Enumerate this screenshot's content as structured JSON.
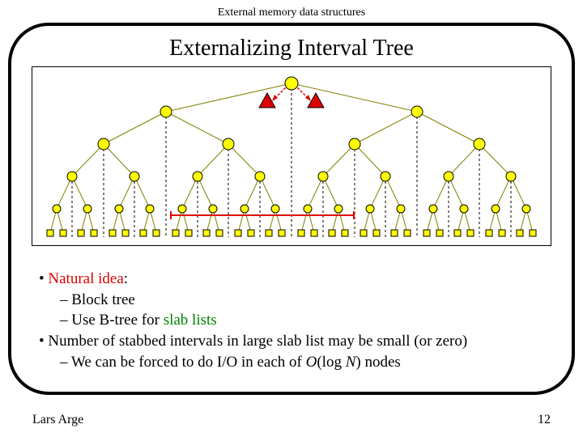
{
  "header": "External memory data structures",
  "title": "Externalizing Interval Tree",
  "bullets": {
    "b1_lead": "Natural idea",
    "b1_tail": ":",
    "b1a": "Block tree",
    "b1b_pre": "Use B-tree for ",
    "b1b_green": "slab lists",
    "b2": "Number of stabbed intervals in large slab list may be small (or zero)",
    "b2a_pre": "We can be forced to do I/O in each of ",
    "b2a_ital": "O",
    "b2a_mid": "(log ",
    "b2a_n": "N",
    "b2a_end": ") nodes"
  },
  "footer": {
    "author": "Lars Arge",
    "page": "12"
  }
}
